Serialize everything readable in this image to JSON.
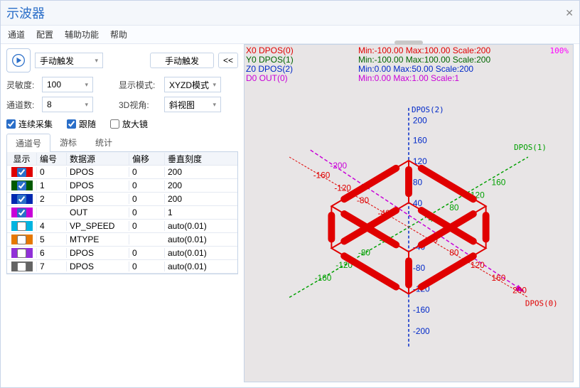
{
  "window": {
    "title": "示波器"
  },
  "menu": {
    "channel": "通道",
    "config": "配置",
    "tools": "辅助功能",
    "help": "帮助"
  },
  "toolbar": {
    "trigger_mode": "手动触发",
    "trigger_btn": "手动触发",
    "collapse": "<<",
    "sensitivity_label": "灵敏度:",
    "sensitivity_value": "100",
    "channels_label": "通道数:",
    "channels_value": "8",
    "display_mode_label": "显示模式:",
    "display_mode_value": "XYZD模式",
    "view3d_label": "3D视角:",
    "view3d_value": "斜视图"
  },
  "checks": {
    "continuous": "连续采集",
    "follow": "跟随",
    "magnifier": "放大镜"
  },
  "tabs": {
    "channel": "通道号",
    "cursor": "游标",
    "stats": "统计"
  },
  "table": {
    "headers": {
      "show": "显示",
      "num": "编号",
      "src": "数据源",
      "off": "偏移",
      "scale": "垂直刻度"
    },
    "rows": [
      {
        "color": "#e00000",
        "checked": true,
        "num": "0",
        "src": "DPOS",
        "off": "0",
        "scale": "200"
      },
      {
        "color": "#005a00",
        "checked": true,
        "num": "1",
        "src": "DPOS",
        "off": "0",
        "scale": "200"
      },
      {
        "color": "#0028b0",
        "checked": true,
        "num": "2",
        "src": "DPOS",
        "off": "0",
        "scale": "200"
      },
      {
        "color": "#c800d8",
        "checked": true,
        "num": " ",
        "src": "OUT",
        "off": "0",
        "scale": "1"
      },
      {
        "color": "#00b4e0",
        "checked": false,
        "num": "4",
        "src": "VP_SPEED",
        "off": "0",
        "scale": "auto(0.01)"
      },
      {
        "color": "#e67800",
        "checked": false,
        "num": "5",
        "src": "MTYPE",
        "off": " ",
        "scale": "auto(0.01)"
      },
      {
        "color": "#9030d8",
        "checked": false,
        "num": "6",
        "src": "DPOS",
        "off": "0",
        "scale": "auto(0.01)"
      },
      {
        "color": "#646464",
        "checked": false,
        "num": "7",
        "src": "DPOS",
        "off": "0",
        "scale": "auto(0.01)"
      }
    ]
  },
  "plot": {
    "percent": "100%",
    "legend": [
      {
        "color": "#e00000",
        "text": "X0 DPOS(0)"
      },
      {
        "color": "#006600",
        "text": "Y0 DPOS(1)"
      },
      {
        "color": "#0028c8",
        "text": "Z0 DPOS(2)"
      },
      {
        "color": "#c800d8",
        "text": "D0 OUT(0)"
      }
    ],
    "ranges": [
      {
        "text": "Min:-100.00  Max:100.00  Scale:200",
        "color": "#e00000"
      },
      {
        "text": "Min:-100.00  Max:100.00  Scale:200",
        "color": "#006600"
      },
      {
        "text": "Min:0.00  Max:50.00  Scale:200",
        "color": "#0028c8"
      },
      {
        "text": "Min:0.00  Max:1.00  Scale:1",
        "color": "#c800d8"
      }
    ],
    "axes": {
      "x": {
        "label": "DPOS(0)",
        "color": "#e00000"
      },
      "y": {
        "label": "DPOS(1)",
        "color": "#00a000"
      },
      "z": {
        "label": "DPOS(2)",
        "color": "#0028c8"
      },
      "d": {
        "color": "#c800d8"
      }
    },
    "ticks": [
      "-200",
      "-160",
      "-120",
      "-80",
      "-40",
      "40",
      "80",
      "120",
      "160",
      "200"
    ]
  }
}
